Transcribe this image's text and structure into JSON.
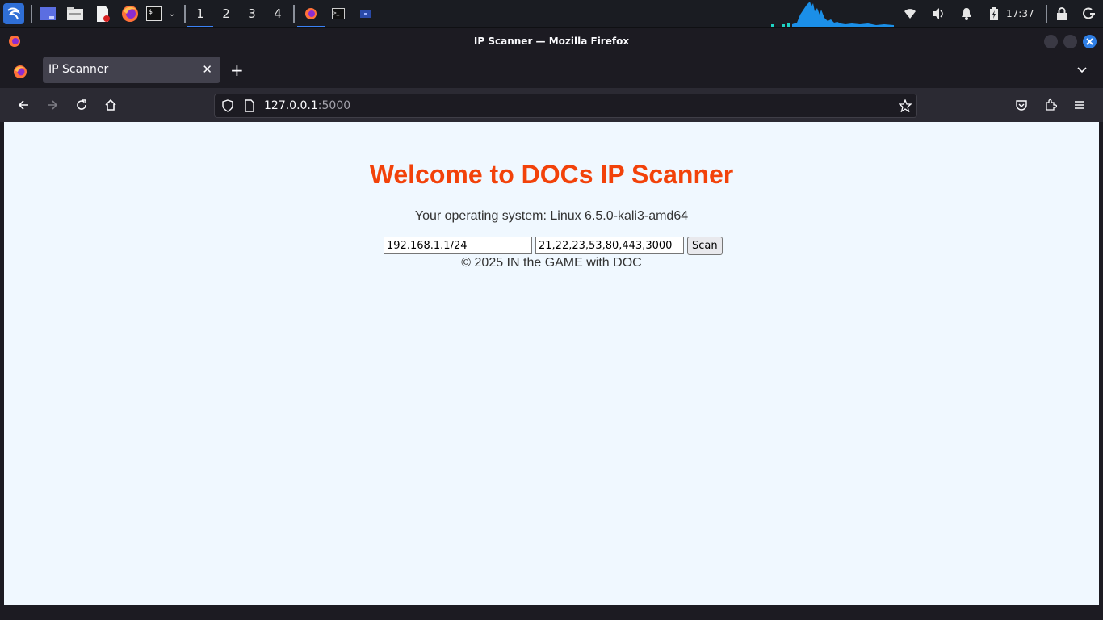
{
  "panel": {
    "workspaces": [
      "1",
      "2",
      "3",
      "4"
    ],
    "active_workspace": "1",
    "clock": "17:37",
    "icons": [
      "kali-menu-icon",
      "desktop-icon",
      "file-manager-icon",
      "text-editor-icon",
      "firefox-icon",
      "terminal-icon",
      "wifi-icon",
      "volume-icon",
      "notification-bell-icon",
      "battery-icon",
      "lock-icon",
      "power-icon"
    ]
  },
  "window": {
    "title": "IP Scanner — Mozilla Firefox"
  },
  "browser": {
    "tab_title": "IP Scanner",
    "url_host": "127.0.0.1",
    "url_port": ":5000"
  },
  "page": {
    "heading": "Welcome to DOCs IP Scanner",
    "os_text": "Your operating system: Linux 6.5.0-kali3-amd64",
    "ip_range_value": "192.168.1.1/24",
    "ports_value": "21,22,23,53,80,443,3000",
    "scan_label": "Scan",
    "footer": "© 2025 IN the GAME with DOC"
  },
  "colors": {
    "heading": "#f2420a",
    "page_background": "#f0f8ff",
    "accent": "#3b82f6"
  }
}
